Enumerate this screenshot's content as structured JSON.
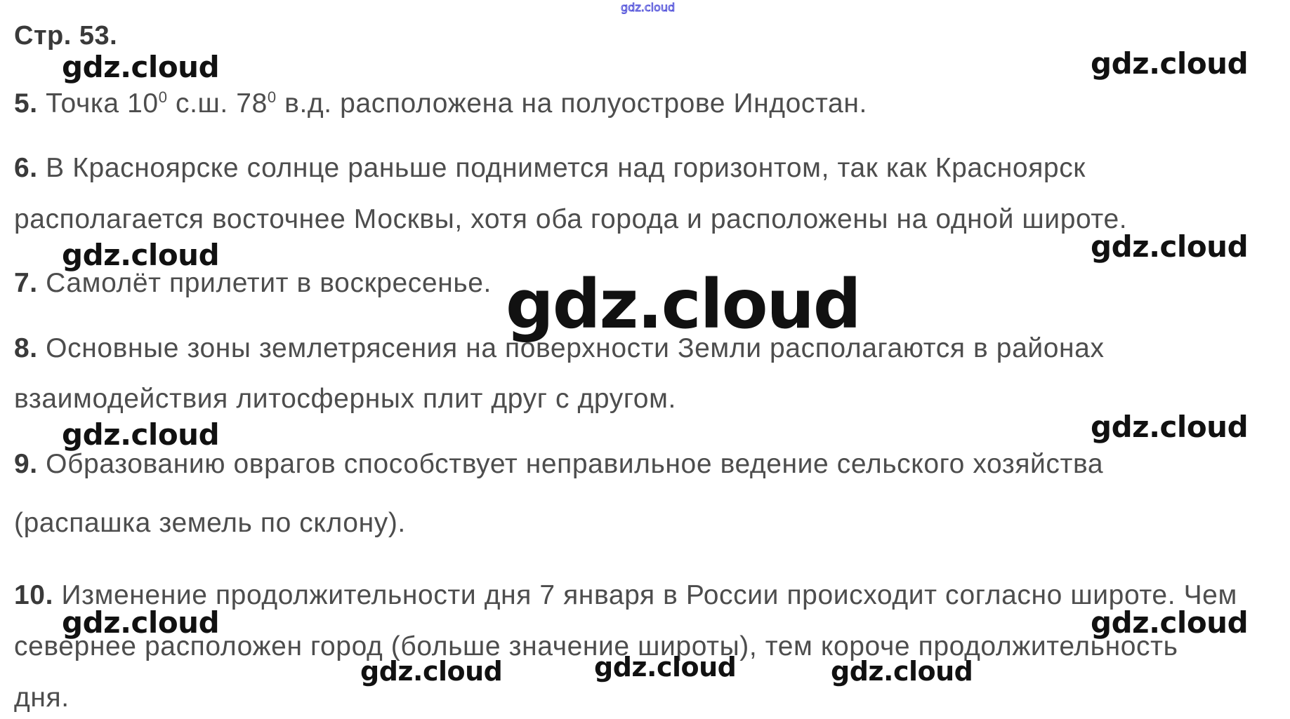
{
  "header": {
    "page": "Стр. 53."
  },
  "answers": [
    {
      "number": "5.",
      "lines": [
        {
          "t1": "Точка 10",
          "sup1": "0",
          "t2": " с.ш. 78",
          "sup2": "0",
          "t3": " в.д. расположена на полуострове Индостан."
        }
      ]
    },
    {
      "number": "6.",
      "lines": [
        "В Красноярске солнце раньше поднимется над горизонтом, так как Красноярск",
        "располагается восточнее Москвы, хотя оба города и расположены на одной широте."
      ]
    },
    {
      "number": "7.",
      "lines": [
        "Самолёт прилетит в воскресенье."
      ]
    },
    {
      "number": "8.",
      "lines": [
        "Основные зоны землетрясения на поверхности Земли располагаются в районах",
        "взаимодействия литосферных плит друг с другом."
      ]
    },
    {
      "number": "9.",
      "lines": [
        "Образованию оврагов способствует неправильное ведение сельского хозяйства",
        "(распашка земель по склону)."
      ]
    },
    {
      "number": "10.",
      "lines": [
        "Изменение продолжительности дня 7 января в России происходит согласно широте. Чем",
        "севернее расположен город (больше значение широты), тем короче продолжительность",
        "дня."
      ]
    }
  ],
  "watermark": {
    "text": "gdz.cloud"
  }
}
